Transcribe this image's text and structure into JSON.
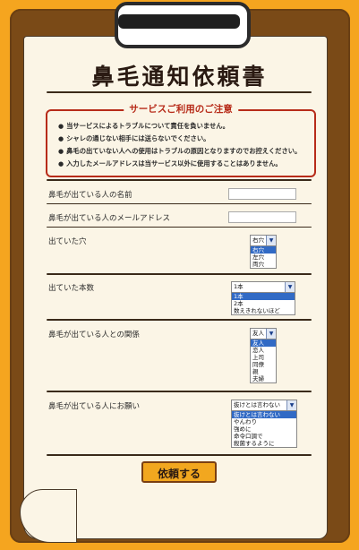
{
  "title": "鼻毛通知依頼書",
  "notice": {
    "title": "サービスご利用のご注意",
    "items": [
      "当サービスによるトラブルについて責任を負いません。",
      "シャレの通じない相手には送らないでください。",
      "鼻毛の出ていない人への使用はトラブルの原因となりますのでお控えください。",
      "入力したメールアドレスは当サービス以外に使用することはありません。"
    ]
  },
  "form": {
    "name_label": "鼻毛が出ている人の名前",
    "name_value": "",
    "email_label": "鼻毛が出ている人のメールアドレス",
    "email_value": "",
    "hole": {
      "label": "出ていた穴",
      "selected": "右穴",
      "options": [
        "右穴",
        "左穴",
        "両穴"
      ]
    },
    "count": {
      "label": "出ていた本数",
      "selected": "1本",
      "options": [
        "1本",
        "2本",
        "数えきれないほど"
      ]
    },
    "relation": {
      "label": "鼻毛が出ている人との関係",
      "selected": "友人",
      "options": [
        "友人",
        "恋人",
        "上司",
        "同僚",
        "親",
        "夫婦"
      ]
    },
    "request": {
      "label": "鼻毛が出ている人にお願い",
      "selected": "抜けとは言わない",
      "options": [
        "抜けとは言わない",
        "やんわり",
        "強めに",
        "命令口調で",
        "殺菌するように"
      ]
    },
    "submit_label": "依頼する"
  }
}
